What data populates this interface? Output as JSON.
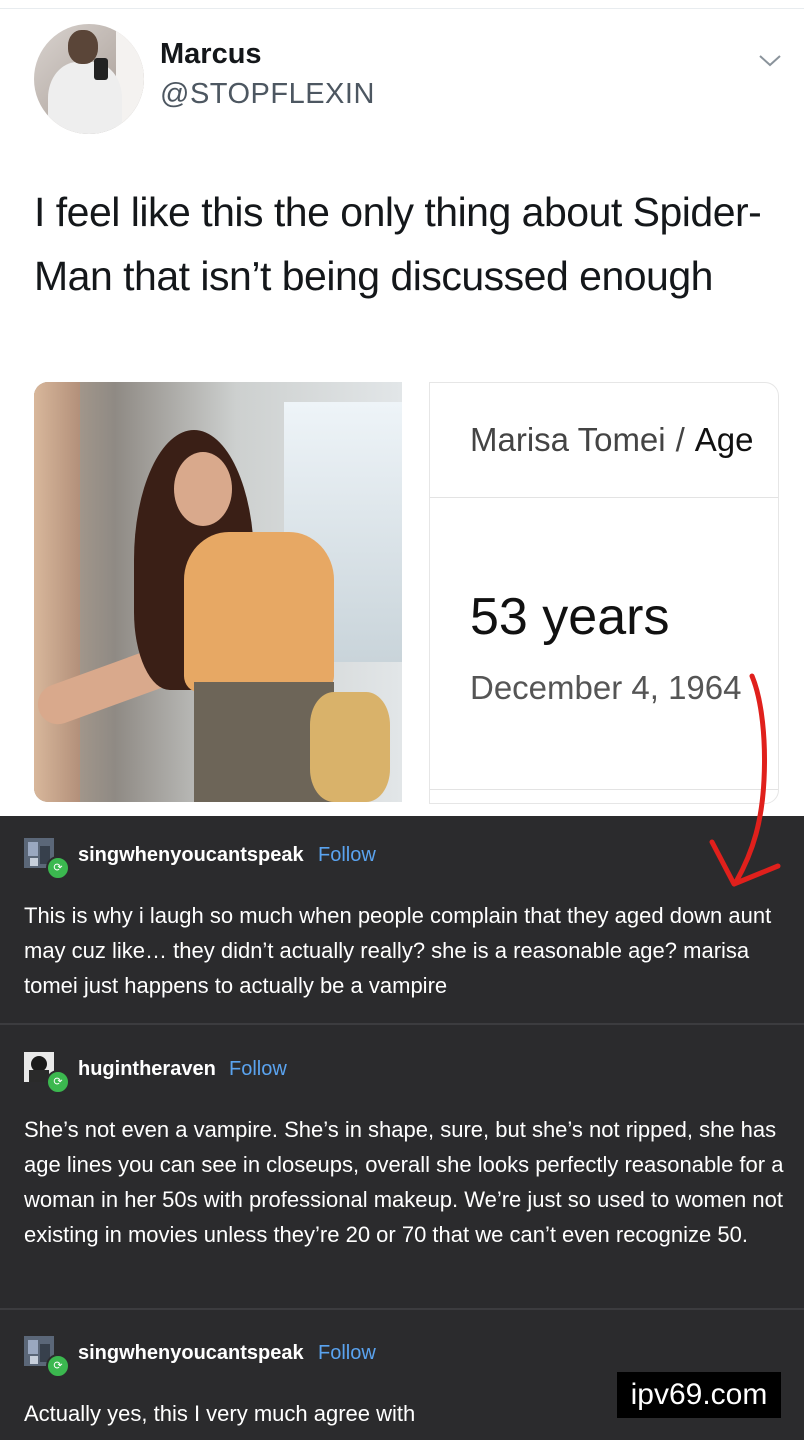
{
  "tweet": {
    "display_name": "Marcus",
    "handle": "@STOPFLEXIN",
    "text": "I feel like this the only thing about Spider-Man that isn’t being discussed enough",
    "menu_icon": "chevron-down-icon"
  },
  "age_card": {
    "subject": "Marisa Tomei",
    "separator": "/",
    "attribute": "Age",
    "value": "53 years",
    "birth_date": "December 4, 1964"
  },
  "annotation": {
    "arrow_color": "#e0201c"
  },
  "posts": [
    {
      "username": "singwhenyoucantspeak",
      "follow_label": "Follow",
      "text": "This is why i laugh so much when people complain that they aged down aunt may cuz like… they didn’t actually really? she is a reasonable age? marisa tomei just happens to actually be a vampire"
    },
    {
      "username": "hugintheraven",
      "follow_label": "Follow",
      "text": "She’s not even a vampire. She’s in shape, sure, but she’s not ripped, she has age lines you can see in closeups, overall she looks perfectly reasonable for a woman in her 50s with professional makeup. We’re just so used to women not existing in movies unless they’re 20 or 70 that we can’t even recognize 50."
    },
    {
      "username": "singwhenyoucantspeak",
      "follow_label": "Follow",
      "text": "Actually yes, this I very much agree with"
    }
  ],
  "watermark": "ipv69.com",
  "colors": {
    "tumblr_background": "#2b2b2d",
    "follow_link": "#5aa3ef",
    "reblog_badge": "#3bb84f"
  }
}
